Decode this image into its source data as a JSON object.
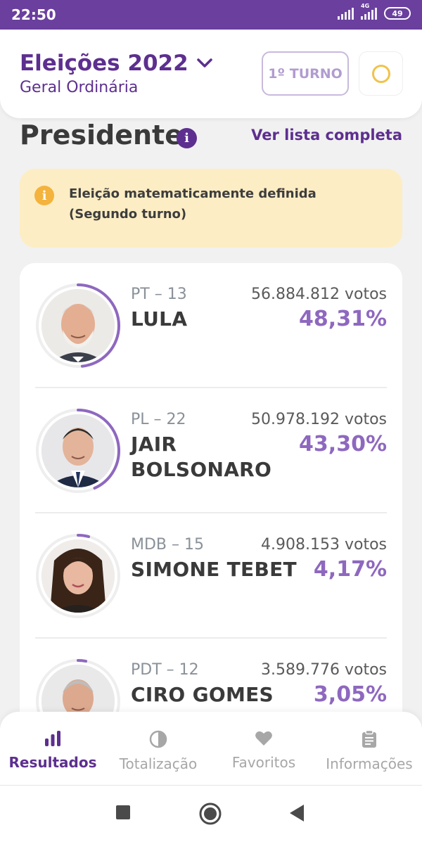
{
  "status_bar": {
    "time": "22:50",
    "network": "4G",
    "battery": "49"
  },
  "header": {
    "title": "Eleições 2022",
    "subtitle": "Geral Ordinária",
    "turno_label": "1º TURNO"
  },
  "section": {
    "title": "Presidente",
    "link": "Ver lista completa"
  },
  "alert": {
    "message": "Eleição matematicamente definida (Segundo turno)"
  },
  "candidates": [
    {
      "party": "PT – 13",
      "name": "LULA",
      "votes": "56.884.812 votos",
      "percent": "48,31%",
      "share": 0.4831
    },
    {
      "party": "PL – 22",
      "name": "JAIR BOLSONARO",
      "votes": "50.978.192 votos",
      "percent": "43,30%",
      "share": 0.433
    },
    {
      "party": "MDB – 15",
      "name": "SIMONE TEBET",
      "votes": "4.908.153 votos",
      "percent": "4,17%",
      "share": 0.0417
    },
    {
      "party": "PDT – 12",
      "name": "CIRO GOMES",
      "votes": "3.589.776 votos",
      "percent": "3,05%",
      "share": 0.0305
    }
  ],
  "bottom_nav": [
    {
      "label": "Resultados",
      "icon": "bar-chart-icon",
      "active": true
    },
    {
      "label": "Totalização",
      "icon": "pie-chart-icon",
      "active": false
    },
    {
      "label": "Favoritos",
      "icon": "heart-icon",
      "active": false
    },
    {
      "label": "Informações",
      "icon": "clipboard-icon",
      "active": false
    }
  ],
  "colors": {
    "brand": "#5d2f8f",
    "accent": "#8e68bf",
    "alert_bg": "#fdedc4",
    "alert_icon": "#f3b33d"
  }
}
